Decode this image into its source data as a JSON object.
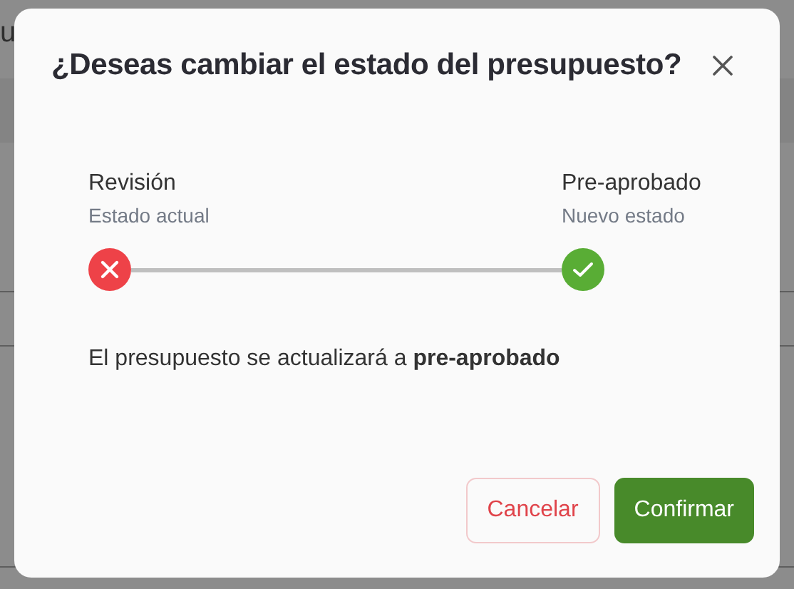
{
  "background": {
    "text": "u"
  },
  "dialog": {
    "title": "¿Deseas cambiar el estado del presupuesto?",
    "steps": [
      {
        "label": "Revisión",
        "caption": "Estado actual",
        "kind": "rejected"
      },
      {
        "label": "Pre-aprobado",
        "caption": "Nuevo estado",
        "kind": "approved"
      }
    ],
    "message": "El presupuesto se actualizará a **pre-aprobado**",
    "buttons": [
      {
        "label": "Cancelar",
        "kind": "secondary"
      },
      {
        "label": "Confirmar",
        "kind": "primary"
      }
    ]
  }
}
